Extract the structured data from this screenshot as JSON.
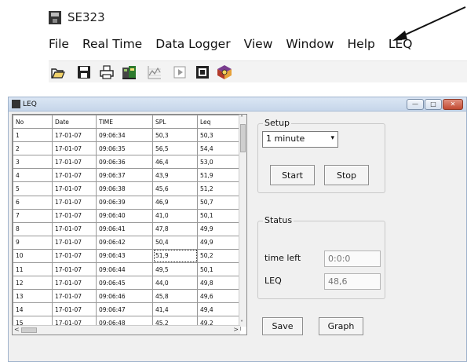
{
  "app": {
    "title": "SE323"
  },
  "menu": [
    "File",
    "Real Time",
    "Data Logger",
    "View",
    "Window",
    "Help",
    "LEQ"
  ],
  "toolbar": [
    "open-folder-icon",
    "save-disk-icon",
    "print-icon",
    "data-logger-icon",
    "graph-icon",
    "play-icon",
    "stop-square-icon",
    "help-book-icon"
  ],
  "window": {
    "title": "LEQ"
  },
  "grid": {
    "columns": [
      "No",
      "Date",
      "TIME",
      "SPL",
      "Leq"
    ],
    "rows": [
      [
        "1",
        "17-01-07",
        "09:06:34",
        "50,3",
        "50,3"
      ],
      [
        "2",
        "17-01-07",
        "09:06:35",
        "56,5",
        "54,4"
      ],
      [
        "3",
        "17-01-07",
        "09:06:36",
        "46,4",
        "53,0"
      ],
      [
        "4",
        "17-01-07",
        "09:06:37",
        "43,9",
        "51,9"
      ],
      [
        "5",
        "17-01-07",
        "09:06:38",
        "45,6",
        "51,2"
      ],
      [
        "6",
        "17-01-07",
        "09:06:39",
        "46,9",
        "50,7"
      ],
      [
        "7",
        "17-01-07",
        "09:06:40",
        "41,0",
        "50,1"
      ],
      [
        "8",
        "17-01-07",
        "09:06:41",
        "47,8",
        "49,9"
      ],
      [
        "9",
        "17-01-07",
        "09:06:42",
        "50,4",
        "49,9"
      ],
      [
        "10",
        "17-01-07",
        "09:06:43",
        "51,9",
        "50,2"
      ],
      [
        "11",
        "17-01-07",
        "09:06:44",
        "49,5",
        "50,1"
      ],
      [
        "12",
        "17-01-07",
        "09:06:45",
        "44,0",
        "49,8"
      ],
      [
        "13",
        "17-01-07",
        "09:06:46",
        "45,8",
        "49,6"
      ],
      [
        "14",
        "17-01-07",
        "09:06:47",
        "41,4",
        "49,4"
      ],
      [
        "15",
        "17-01-07",
        "09:06:48",
        "45,2",
        "49,2"
      ]
    ]
  },
  "setup": {
    "legend": "Setup",
    "interval": "1 minute",
    "start": "Start",
    "stop": "Stop"
  },
  "status": {
    "legend": "Status",
    "time_left_label": "time left",
    "time_left_value": "0:0:0",
    "leq_label": "LEQ",
    "leq_value": "48,6"
  },
  "actions": {
    "save": "Save",
    "graph": "Graph"
  }
}
